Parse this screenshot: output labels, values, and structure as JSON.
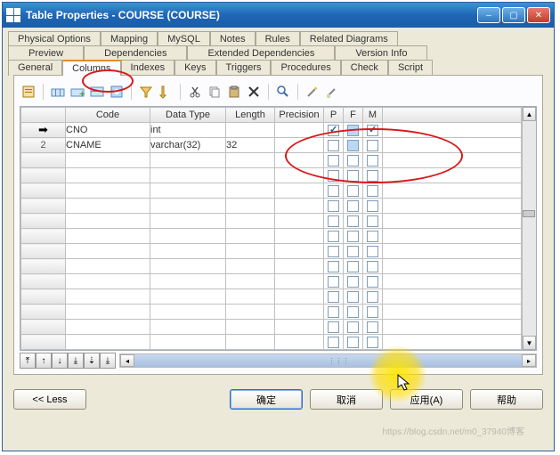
{
  "window": {
    "title": "Table Properties - COURSE (COURSE)"
  },
  "tabs": {
    "row1": [
      "Physical Options",
      "Mapping",
      "MySQL",
      "Notes",
      "Rules",
      "Related Diagrams"
    ],
    "row2": [
      "Preview",
      "Dependencies",
      "Extended Dependencies",
      "Version Info"
    ],
    "row3": [
      "General",
      "Columns",
      "Indexes",
      "Keys",
      "Triggers",
      "Procedures",
      "Check",
      "Script"
    ],
    "active": "Columns"
  },
  "grid": {
    "headers": {
      "code": "Code",
      "datatype": "Data Type",
      "length": "Length",
      "precision": "Precision",
      "p": "P",
      "f": "F",
      "m": "M"
    },
    "rows": [
      {
        "idx_icon": "arrow",
        "code": "CNO",
        "datatype": "int",
        "length": "",
        "precision": "",
        "P": true,
        "F": "blue-off",
        "M": true
      },
      {
        "idx": "2",
        "code": "CNAME",
        "datatype": "varchar(32)",
        "length": "32",
        "precision": "",
        "P": false,
        "F": "blue-off",
        "M": false
      }
    ]
  },
  "buttons": {
    "less": "<< Less",
    "ok": "确定",
    "cancel": "取消",
    "apply": "应用(A)",
    "help": "帮助"
  },
  "watermark": "https://blog.csdn.net/m0_37940博客",
  "icons": {
    "minimize": "–",
    "maximize": "▢",
    "close": "✕",
    "arrow_indicator": "➡"
  }
}
